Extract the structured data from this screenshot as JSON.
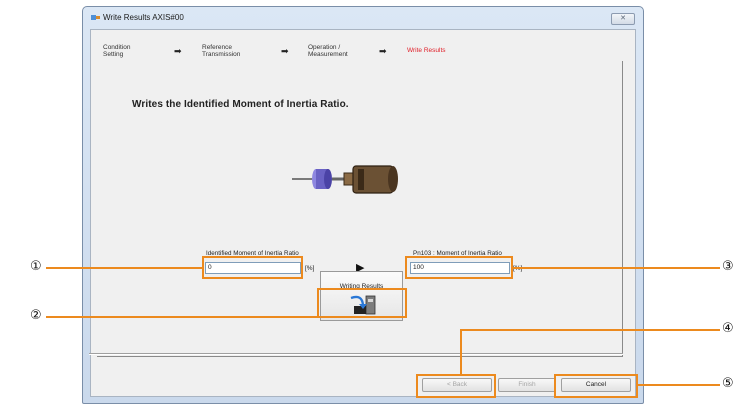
{
  "window": {
    "title": "Write Results AXIS#00",
    "close_label": "✕"
  },
  "steps": [
    {
      "label": "Condition\nSetting",
      "active": false
    },
    {
      "label": "Reference\nTransmission",
      "active": false
    },
    {
      "label": "Operation /\nMeasurement",
      "active": false
    },
    {
      "label": "Write Results",
      "active": true
    }
  ],
  "step_arrow": "➡",
  "main": {
    "headline": "Writes the Identified Moment of Inertia Ratio.",
    "identified": {
      "label": "Identified Moment of Inertia Ratio",
      "value": "0",
      "unit": "[%]"
    },
    "transfer_arrow": "▶",
    "parameter": {
      "label": "Pn103  :  Moment of Inertia Ratio",
      "value": "100",
      "unit": "[%]"
    },
    "write_button_label": "Writing Results"
  },
  "footer": {
    "back_label": "< Back",
    "finish_label": "Finish",
    "cancel_label": "Cancel"
  },
  "callouts": [
    "①",
    "②",
    "③",
    "④",
    "⑤"
  ],
  "colors": {
    "highlight": "#ec8a1e",
    "active_step": "#e0202a",
    "motor_body": "#6b5134",
    "load_disk": "#6a62c4"
  }
}
